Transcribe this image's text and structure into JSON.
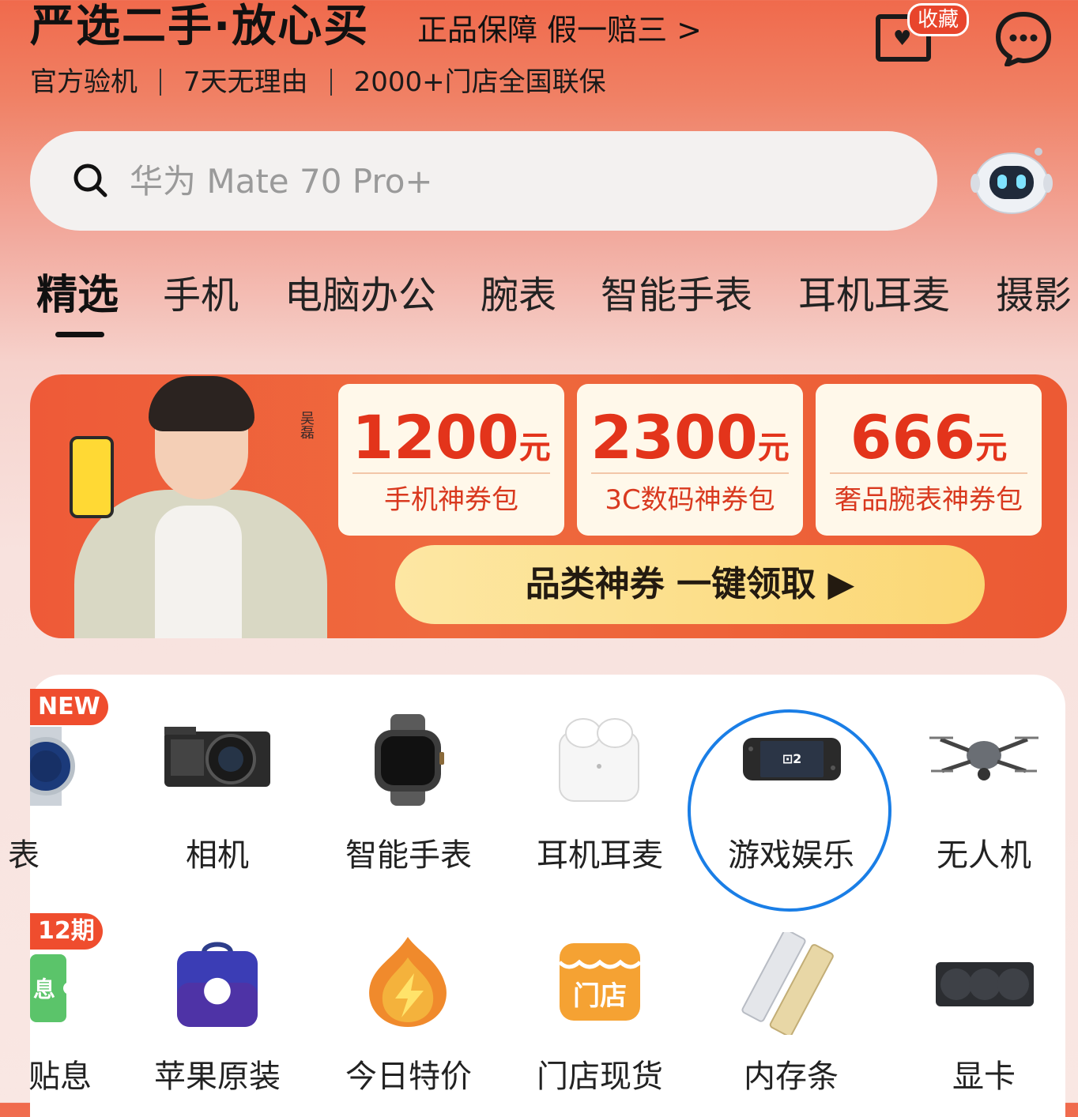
{
  "header": {
    "title": "严选二手·放心买",
    "guarantee": "正品保障 假一赔三 >",
    "features": [
      "官方验机",
      "7天无理由",
      "2000+门店全国联保"
    ],
    "favorites_badge": "收藏"
  },
  "search": {
    "placeholder": "华为 Mate 70 Pro+"
  },
  "tabs": [
    "精选",
    "手机",
    "电脑办公",
    "腕表",
    "智能手表",
    "耳机耳麦",
    "摄影"
  ],
  "banner": {
    "coupons": [
      {
        "amount": "1200",
        "unit": "元",
        "label": "手机神券包"
      },
      {
        "amount": "2300",
        "unit": "元",
        "label": "3C数码神券包"
      },
      {
        "amount": "666",
        "unit": "元",
        "label": "奢品腕表神券包"
      }
    ],
    "claim_label": "品类神券 一键领取 ▶",
    "endorser": "吴磊"
  },
  "categories": {
    "row1": [
      "表",
      "相机",
      "智能手表",
      "耳机耳麦",
      "游戏娱乐",
      "无人机"
    ],
    "row2": [
      "贴息",
      "苹果原装",
      "今日特价",
      "门店现货",
      "内存条",
      "显卡"
    ],
    "badge_new": "NEW",
    "badge_installment": "12期"
  },
  "colors": {
    "accent": "#e8452c",
    "highlight_circle": "#1a7ee6"
  }
}
